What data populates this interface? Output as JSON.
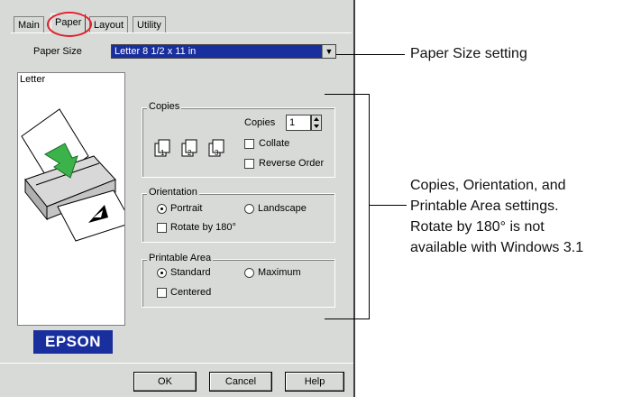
{
  "tabs": [
    "Main",
    "Paper",
    "Layout",
    "Utility"
  ],
  "paper_size": {
    "label": "Paper Size",
    "value": "Letter 8 1/2 x 11 in"
  },
  "preview": {
    "label": "Letter"
  },
  "copies_group": {
    "title": "Copies",
    "copies_label": "Copies",
    "copies_value": "1",
    "collate_label": "Collate",
    "reverse_label": "Reverse Order",
    "collate_checked": false,
    "reverse_checked": false
  },
  "orientation_group": {
    "title": "Orientation",
    "portrait_label": "Portrait",
    "landscape_label": "Landscape",
    "rotate_label": "Rotate by 180°",
    "selected": "Portrait"
  },
  "printable_area_group": {
    "title": "Printable Area",
    "standard_label": "Standard",
    "maximum_label": "Maximum",
    "centered_label": "Centered",
    "selected": "Standard"
  },
  "brand_logo": "EPSON",
  "buttons": {
    "ok": "OK",
    "cancel": "Cancel",
    "help": "Help"
  },
  "callouts": {
    "paper_size_setting": "Paper Size setting",
    "settings_lines": [
      "Copies, Orientation, and",
      "Printable Area settings.",
      "Rotate by 180° is not",
      "available with Windows 3.1"
    ]
  },
  "colors": {
    "dialog_bg": "#d8dad8",
    "selection": "#1a2f9e",
    "highlight_ring": "#e0202a",
    "printer_arrow": "#3bb34a"
  }
}
